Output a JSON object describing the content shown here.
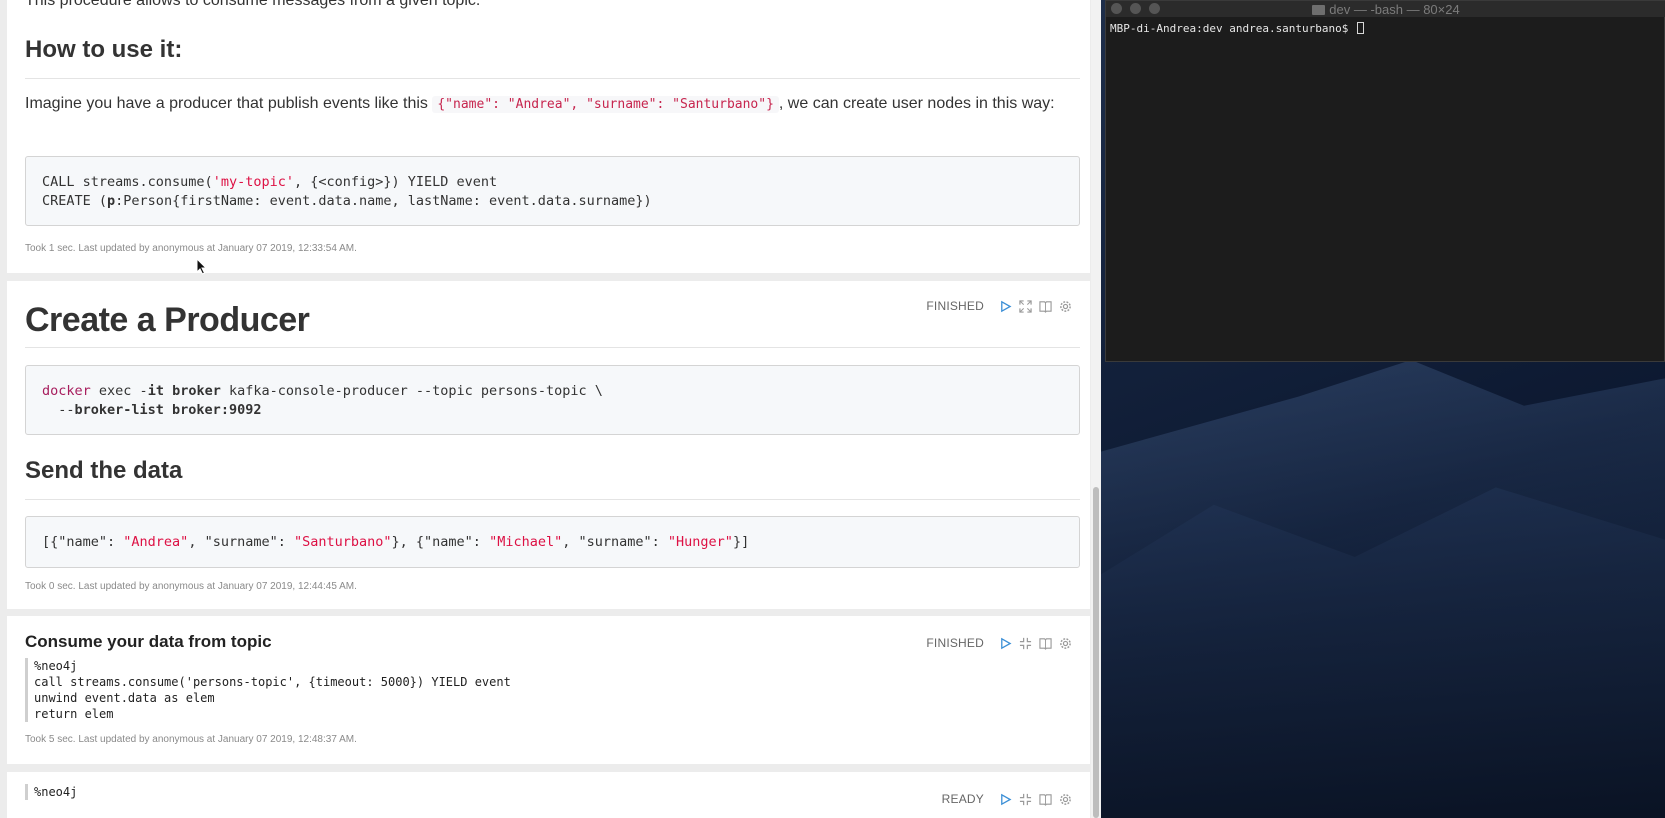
{
  "notebook": {
    "p1": {
      "intro": "This procedure allows to consume messages from a given topic.",
      "heading": "How to use it:",
      "text_before": "Imagine you have a producer that publish events like this ",
      "inline_code": "{\"name\": \"Andrea\", \"surname\": \"Santurbano\"}",
      "text_after": ", we can create user nodes in this way:",
      "code": {
        "l1_a": "CALL streams.consume(",
        "l1_b": "'my-topic'",
        "l1_c": ", {<config>}) YIELD event",
        "l2_a": "CREATE (",
        "l2_b": "p",
        "l2_c": ":Person{firstName: event.data.name, lastName: event.data.surname})"
      },
      "meta": "Took 1 sec. Last updated by anonymous at January 07 2019, 12:33:54 AM."
    },
    "p2": {
      "heading": "Create a Producer",
      "status": "FINISHED",
      "code": {
        "l1_a": "docker",
        "l1_b": " exec -",
        "l1_c": "it broker",
        "l1_d": " kafka-console-producer --topic persons-topic \\",
        "l2_a": "  --",
        "l2_b": "broker-list broker:9092"
      },
      "subheading": "Send the data",
      "data": {
        "s1": "[{\"name\": ",
        "s2": "\"Andrea\"",
        "s3": ", \"surname\": ",
        "s4": "\"Santurbano\"",
        "s5": "}, {\"name\": ",
        "s6": "\"Michael\"",
        "s7": ", \"surname\": ",
        "s8": "\"Hunger\"",
        "s9": "}]"
      },
      "meta": "Took 0 sec. Last updated by anonymous at January 07 2019, 12:44:45 AM."
    },
    "p3": {
      "heading": "Consume your data from topic",
      "status": "FINISHED",
      "lines": [
        "%neo4j",
        "call streams.consume('persons-topic', {timeout: 5000}) YIELD event",
        "unwind event.data as elem",
        "return elem"
      ],
      "meta": "Took 5 sec. Last updated by anonymous at January 07 2019, 12:48:37 AM."
    },
    "p4": {
      "status": "READY",
      "line": "%neo4j"
    }
  },
  "terminal": {
    "title": "dev — -bash — 80×24",
    "prompt": "MBP-di-Andrea:dev andrea.santurbano$ "
  },
  "colors": {
    "code_string": "#dd1144",
    "code_keyword": "#a71d5d",
    "control_blue": "#3b8fd6",
    "terminal_bg": "#1c1c1c"
  }
}
